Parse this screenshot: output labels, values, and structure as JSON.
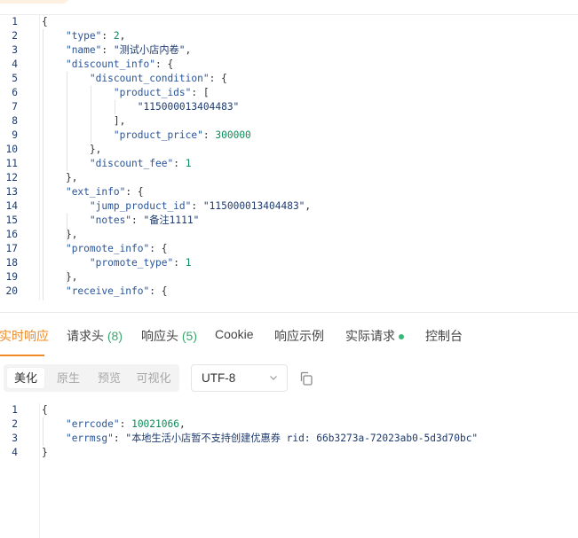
{
  "request_editor": {
    "lines": [
      {
        "n": "1",
        "text": "{"
      },
      {
        "n": "2",
        "text": "    \"type\": 2,"
      },
      {
        "n": "3",
        "text": "    \"name\": \"测试小店内卷\","
      },
      {
        "n": "4",
        "text": "    \"discount_info\": {"
      },
      {
        "n": "5",
        "text": "        \"discount_condition\": {"
      },
      {
        "n": "6",
        "text": "            \"product_ids\": ["
      },
      {
        "n": "7",
        "text": "                \"115000013404483\""
      },
      {
        "n": "8",
        "text": "            ],"
      },
      {
        "n": "9",
        "text": "            \"product_price\": 300000"
      },
      {
        "n": "10",
        "text": "        },"
      },
      {
        "n": "11",
        "text": "        \"discount_fee\": 1"
      },
      {
        "n": "12",
        "text": "    },"
      },
      {
        "n": "13",
        "text": "    \"ext_info\": {"
      },
      {
        "n": "14",
        "text": "        \"jump_product_id\": \"115000013404483\","
      },
      {
        "n": "15",
        "text": "        \"notes\": \"备注1111\""
      },
      {
        "n": "16",
        "text": "    },"
      },
      {
        "n": "17",
        "text": "    \"promote_info\": {"
      },
      {
        "n": "18",
        "text": "        \"promote_type\": 1"
      },
      {
        "n": "19",
        "text": "    },"
      },
      {
        "n": "20",
        "text": "    \"receive_info\": {"
      }
    ]
  },
  "tabs": [
    {
      "label": "实时响应",
      "count": "",
      "dot": false,
      "active": true
    },
    {
      "label": "请求头",
      "count": "(8)",
      "dot": false,
      "active": false
    },
    {
      "label": "响应头",
      "count": "(5)",
      "dot": false,
      "active": false
    },
    {
      "label": "Cookie",
      "count": "",
      "dot": false,
      "active": false
    },
    {
      "label": "响应示例",
      "count": "",
      "dot": false,
      "active": false
    },
    {
      "label": "实际请求",
      "count": "",
      "dot": true,
      "active": false
    },
    {
      "label": "控制台",
      "count": "",
      "dot": false,
      "active": false
    }
  ],
  "toolbar": {
    "view_modes": [
      "美化",
      "原生",
      "预览",
      "可视化"
    ],
    "active_view_mode": "美化",
    "encoding": "UTF-8"
  },
  "response_editor": {
    "lines": [
      {
        "n": "1",
        "text": "{"
      },
      {
        "n": "2",
        "text": "    \"errcode\": 10021066,"
      },
      {
        "n": "3",
        "text": "    \"errmsg\": \"本地生活小店暂不支持创建优惠券 rid: 66b3273a-72023ab0-5d3d70bc\""
      },
      {
        "n": "4",
        "text": "}"
      }
    ]
  },
  "colors": {
    "accent": "#f08a24",
    "count_green": "#3aa76d",
    "dot_green": "#3ab77a",
    "json_key": "#2a5599",
    "json_string": "#1f3b6e",
    "json_number": "#108a5a"
  },
  "icons": {
    "chevron": "chevron-down-icon",
    "copy": "copy-icon"
  }
}
